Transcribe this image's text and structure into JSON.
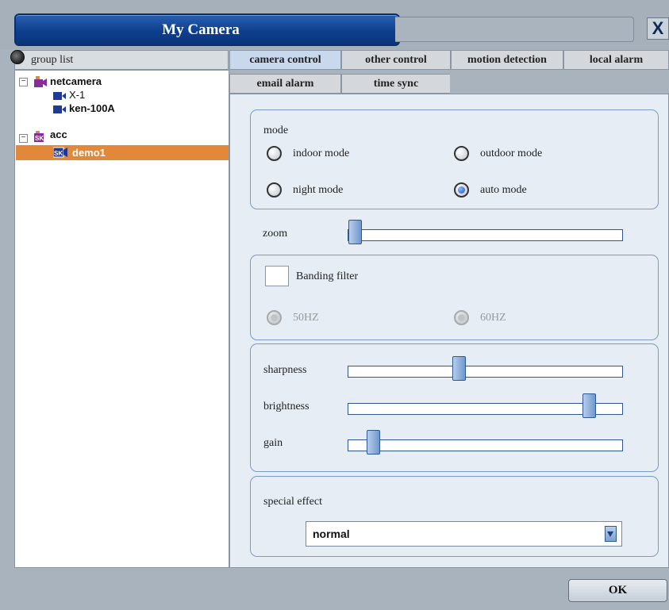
{
  "window": {
    "title": "My Camera",
    "close_label": "X"
  },
  "tree": {
    "header": "group list",
    "groups": [
      {
        "label": "netcamera",
        "expander": "−",
        "cameras": [
          "X-1",
          "ken-100A"
        ]
      },
      {
        "label": "acc",
        "expander": "−",
        "cameras": [
          "demo1"
        ]
      }
    ],
    "selected": "demo1"
  },
  "tabs": [
    "camera control",
    "other control",
    "motion detection",
    "local alarm",
    "email alarm",
    "time sync"
  ],
  "active_tab": "camera control",
  "mode": {
    "title": "mode",
    "options": [
      "indoor mode",
      "outdoor mode",
      "night mode",
      "auto mode"
    ],
    "selected": "auto mode"
  },
  "zoom": {
    "label": "zoom",
    "level": 0.0
  },
  "banding": {
    "label": "Banding filter",
    "checked": false,
    "options": [
      "50HZ",
      "60HZ"
    ],
    "enabled": false
  },
  "image": {
    "sharpness": {
      "label": "sharpness",
      "level": 0.4
    },
    "brightness": {
      "label": "brightness",
      "level": 0.9
    },
    "gain": {
      "label": "gain",
      "level": 0.07
    }
  },
  "special_effect": {
    "label": "special effect",
    "value": "normal"
  },
  "ok_label": "OK",
  "colors": {
    "title_bar": "#0d3f8e",
    "selection": "#e1883b",
    "content_bg": "#e6edf5"
  }
}
